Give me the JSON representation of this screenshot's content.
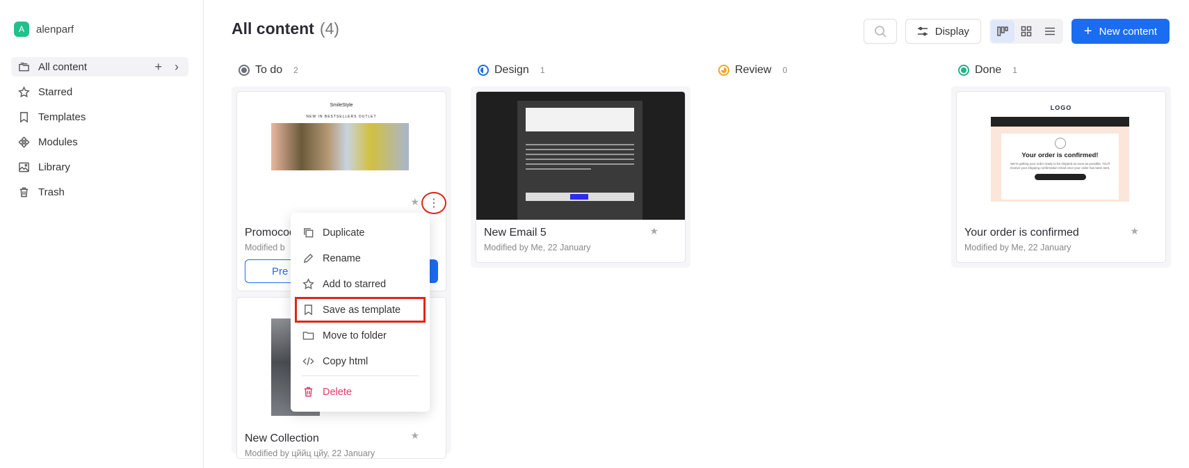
{
  "workspace": {
    "initial": "A",
    "name": "alenparf"
  },
  "sidebar": {
    "items": [
      {
        "label": "All content",
        "icon": "folders-icon"
      },
      {
        "label": "Starred",
        "icon": "star-icon"
      },
      {
        "label": "Templates",
        "icon": "bookmark-icon"
      },
      {
        "label": "Modules",
        "icon": "modules-icon"
      },
      {
        "label": "Library",
        "icon": "image-icon"
      },
      {
        "label": "Trash",
        "icon": "trash-icon"
      }
    ]
  },
  "header": {
    "title": "All content",
    "count": "(4)"
  },
  "toolbar": {
    "display_label": "Display",
    "new_label": "New content"
  },
  "columns": [
    {
      "title": "To do",
      "count": "2",
      "color": "#6b6f7b"
    },
    {
      "title": "Design",
      "count": "1",
      "color": "#1a6df1"
    },
    {
      "title": "Review",
      "count": "0",
      "color": "#f0a820"
    },
    {
      "title": "Done",
      "count": "1",
      "color": "#20b38a"
    }
  ],
  "cards": {
    "promocode": {
      "title": "Promocode",
      "sub": "Modified b",
      "preview_label": "Pre",
      "logo": "SmileStyle",
      "nav": "NEW IN   BESTSELLERS   OUTLET"
    },
    "new_collection": {
      "title": "New Collection",
      "sub": "Modified by цййц цйу, 22 January"
    },
    "new_email_5": {
      "title": "New Email 5",
      "sub": "Modified by Me, 22 January"
    },
    "order_confirmed": {
      "title": "Your order is confirmed",
      "sub": "Modified by Me, 22 January",
      "logo": "LOGO",
      "headline": "Your order is confirmed!",
      "text": "We're getting your order ready to be shipped as soon as possible. You'll receive your shipping confirmation email once your order has been sent."
    }
  },
  "menu": {
    "items": [
      {
        "label": "Duplicate"
      },
      {
        "label": "Rename"
      },
      {
        "label": "Add to starred"
      },
      {
        "label": "Save as template"
      },
      {
        "label": "Move to folder"
      },
      {
        "label": "Copy html"
      },
      {
        "label": "Delete"
      }
    ]
  }
}
